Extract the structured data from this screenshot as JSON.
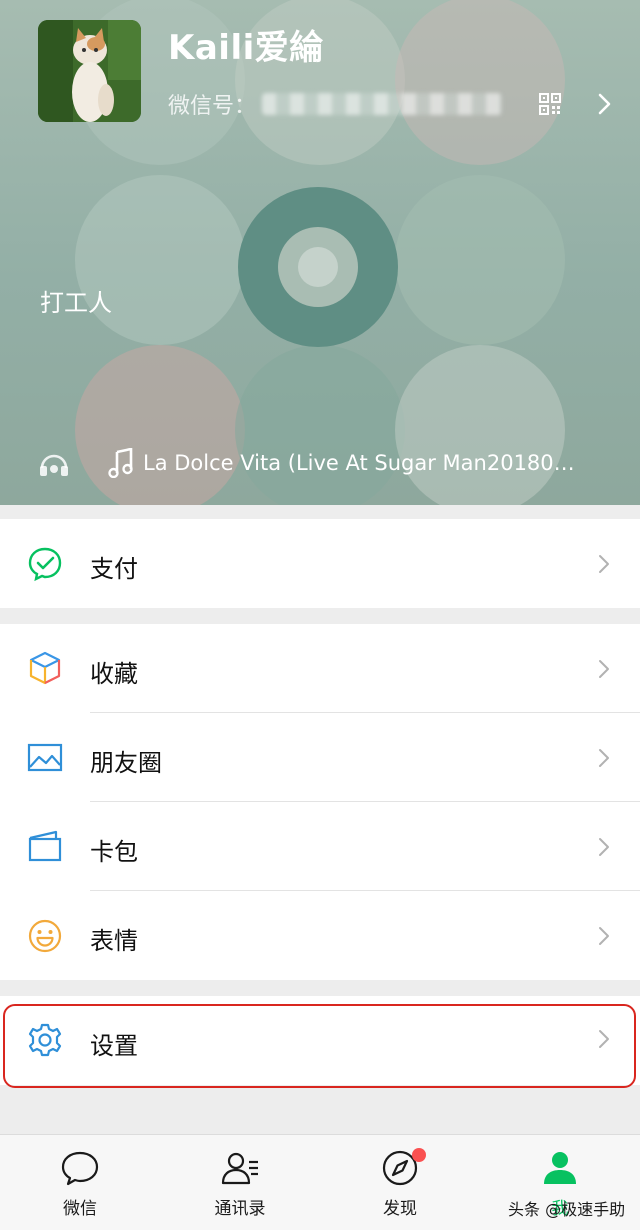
{
  "profile": {
    "nickname": "Kaili爱綸",
    "wechat_id_label": "微信号：",
    "status_text": "打工人",
    "music_title": "La Dolce Vita (Live At Sugar Man20180…"
  },
  "menu": {
    "pay": "支付",
    "favorites": "收藏",
    "moments": "朋友圈",
    "cards": "卡包",
    "stickers": "表情",
    "settings": "设置"
  },
  "tabs": [
    {
      "label": "微信"
    },
    {
      "label": "通讯录"
    },
    {
      "label": "发现"
    },
    {
      "label": "我"
    }
  ],
  "watermark": "头条 @极速手助",
  "colors": {
    "accent_green": "#07c160",
    "highlight_red": "#d9261f",
    "badge_red": "#fa5151"
  }
}
